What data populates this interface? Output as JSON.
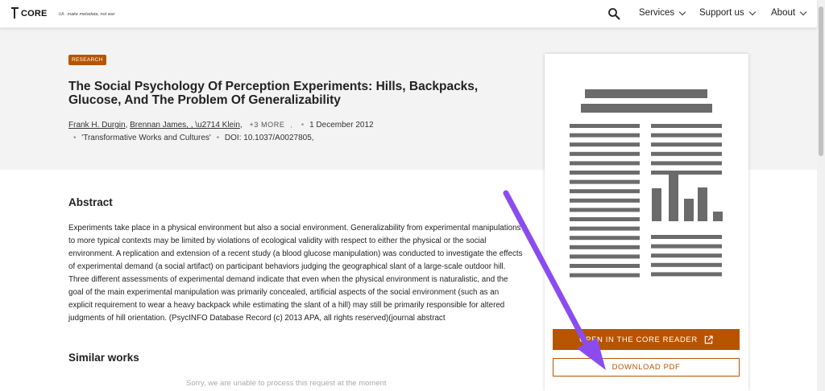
{
  "header": {
    "logo_text": "CORE",
    "logo_sub": "UA",
    "tagline": "make metadata, not war",
    "nav": [
      {
        "label": "Services"
      },
      {
        "label": "Support us"
      },
      {
        "label": "About"
      }
    ]
  },
  "article": {
    "badge": "RESEARCH",
    "title": "The Social Psychology Of Perception Experiments: Hills, Backpacks, Glucose, And The Problem Of Generalizability",
    "authors": [
      "Frank H. Durgin",
      "Brennan James, , \\u2714 Klein"
    ],
    "more_authors": "+3 MORE",
    "date": "1 December 2012",
    "journal": "'Transformative Works and Cultures'",
    "doi": "DOI: 10.1037/A0027805"
  },
  "abstract": {
    "heading": "Abstract",
    "text": "Experiments take place in a physical environment but also a social environment. Generalizability from experimental manipulations to more typical contexts may be limited by violations of ecological validity with respect to either the physical or the social environment. A replication and extension of a recent study (a blood glucose manipulation) was conducted to investigate the effects of experimental demand (a social artifact) on participant behaviors judging the geographical slant of a large-scale outdoor hill. Three different assessments of experimental demand indicate that even when the physical environment is naturalistic, and the goal of the main experimental manipulation was primarily concealed, artificial aspects of the social environment (such as an explicit requirement to wear a heavy backpack while estimating the slant of a hill) may still be primarily responsible for altered judgments of hill orientation. (PsycINFO Database Record (c) 2013 APA, all rights reserved)(journal abstract"
  },
  "similar": {
    "heading": "Similar works",
    "message": "Sorry, we are unable to process this request at the moment"
  },
  "sidebar": {
    "reader_button": "OPEN IN THE CORE READER",
    "download_button": "DOWNLOAD PDF"
  },
  "colors": {
    "accent": "#b75400",
    "annotation": "#8a4cf0"
  }
}
